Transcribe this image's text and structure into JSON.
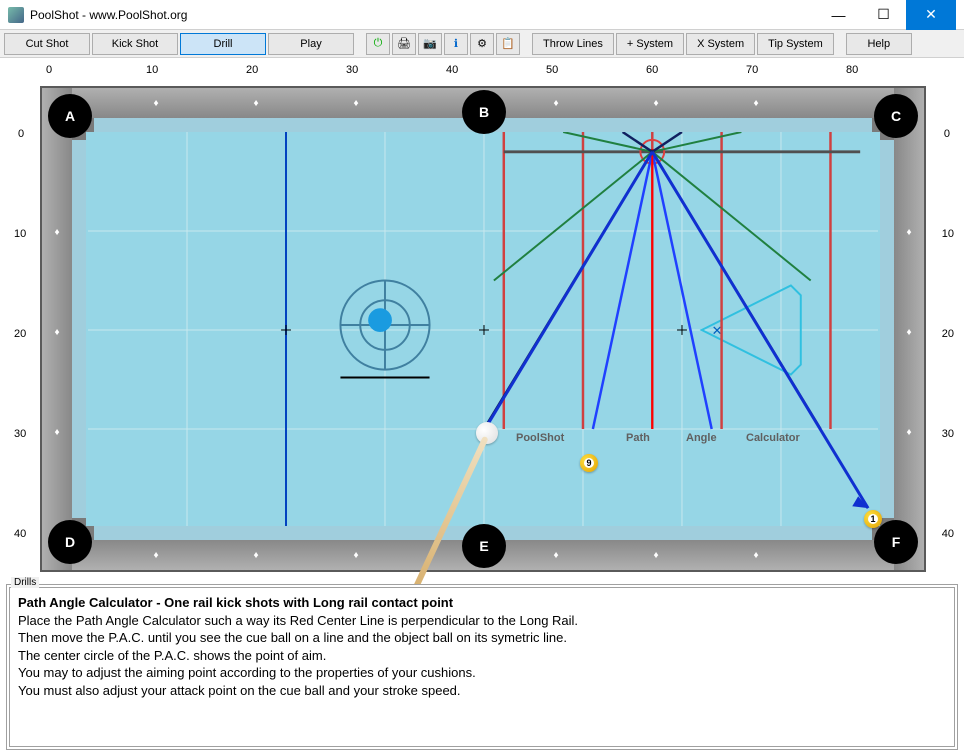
{
  "window": {
    "title": "PoolShot - www.PoolShot.org"
  },
  "toolbar": {
    "cut_shot": "Cut Shot",
    "kick_shot": "Kick Shot",
    "drill": "Drill",
    "play": "Play",
    "throw_lines": "Throw Lines",
    "plus_system": "+ System",
    "x_system": "X System",
    "tip_system": "Tip System",
    "help": "Help"
  },
  "axis": {
    "top": [
      "0",
      "10",
      "20",
      "30",
      "40",
      "50",
      "60",
      "70",
      "80"
    ],
    "left": [
      "0",
      "10",
      "20",
      "30",
      "40"
    ],
    "right": [
      "0",
      "10",
      "20",
      "30",
      "40"
    ]
  },
  "pockets": {
    "A": "A",
    "B": "B",
    "C": "C",
    "D": "D",
    "E": "E",
    "F": "F"
  },
  "pac_labels": {
    "l1": "PoolShot",
    "l2": "Path",
    "l3": "Angle",
    "l4": "Calculator"
  },
  "balls": {
    "nine": "9",
    "one": "1"
  },
  "drills": {
    "panel_label": "Drills",
    "title": "Path Angle Calculator - One rail kick shots with Long rail contact point",
    "line1": "Place the Path Angle Calculator such a way its Red Center Line is perpendicular to the Long Rail.",
    "line2": "Then move the P.A.C. until you see the cue ball on a line and the object ball on its symetric line.",
    "line3": "The center circle of the P.A.C. shows the point of aim.",
    "line4": "You may to adjust the aiming point according to the properties of your cushions.",
    "line5": "You must also adjust your attack point on the cue ball and your stroke speed."
  }
}
